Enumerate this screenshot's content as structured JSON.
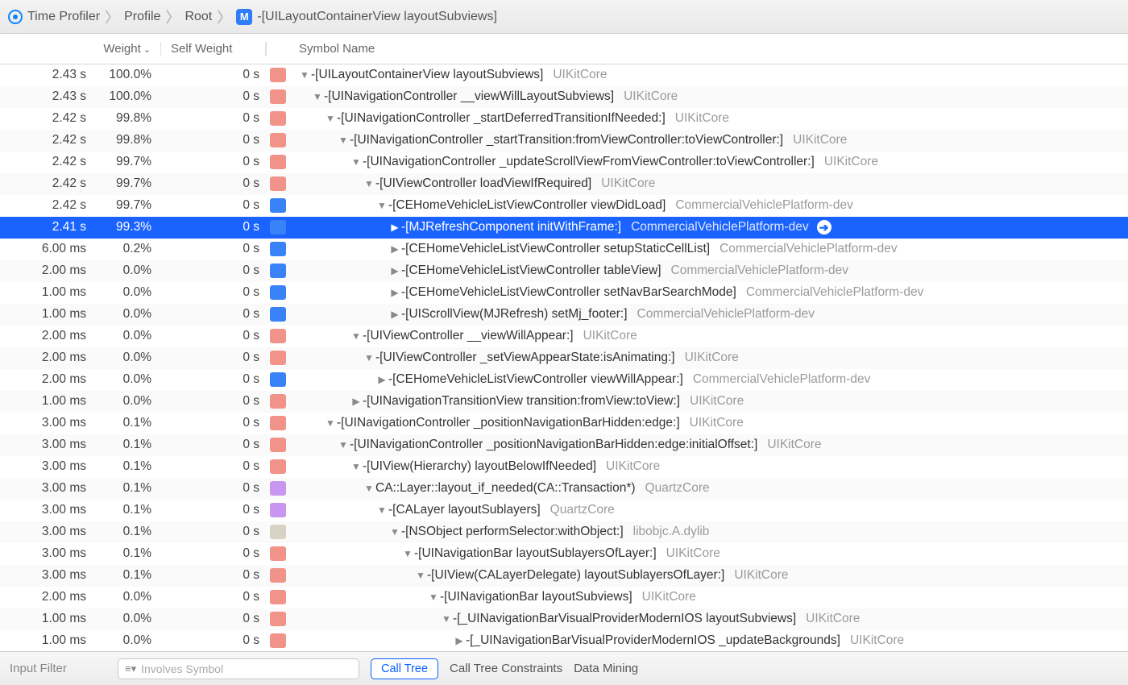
{
  "breadcrumb": {
    "items": [
      "Time Profiler",
      "Profile",
      "Root"
    ],
    "leaf_badge": "M",
    "leaf": "-[UILayoutContainerView layoutSubviews]"
  },
  "columns": {
    "weight": "Weight",
    "self": "Self Weight",
    "symbol": "Symbol Name"
  },
  "rows": [
    {
      "t": "2.43 s",
      "p": "100.0%",
      "s": "0 s",
      "ic": "sys",
      "d": 0,
      "e": "open",
      "sym": "-[UILayoutContainerView layoutSubviews]",
      "lib": "UIKitCore"
    },
    {
      "t": "2.43 s",
      "p": "100.0%",
      "s": "0 s",
      "ic": "sys",
      "d": 1,
      "e": "open",
      "sym": "-[UINavigationController __viewWillLayoutSubviews]",
      "lib": "UIKitCore"
    },
    {
      "t": "2.42 s",
      "p": "99.8%",
      "s": "0 s",
      "ic": "sys",
      "d": 2,
      "e": "open",
      "sym": "-[UINavigationController _startDeferredTransitionIfNeeded:]",
      "lib": "UIKitCore"
    },
    {
      "t": "2.42 s",
      "p": "99.8%",
      "s": "0 s",
      "ic": "sys",
      "d": 3,
      "e": "open",
      "sym": "-[UINavigationController _startTransition:fromViewController:toViewController:]",
      "lib": "UIKitCore"
    },
    {
      "t": "2.42 s",
      "p": "99.7%",
      "s": "0 s",
      "ic": "sys",
      "d": 4,
      "e": "open",
      "sym": "-[UINavigationController _updateScrollViewFromViewController:toViewController:]",
      "lib": "UIKitCore"
    },
    {
      "t": "2.42 s",
      "p": "99.7%",
      "s": "0 s",
      "ic": "sys",
      "d": 5,
      "e": "open",
      "sym": "-[UIViewController loadViewIfRequired]",
      "lib": "UIKitCore"
    },
    {
      "t": "2.42 s",
      "p": "99.7%",
      "s": "0 s",
      "ic": "app",
      "d": 6,
      "e": "open",
      "sym": "-[CEHomeVehicleListViewController viewDidLoad]",
      "lib": "CommercialVehiclePlatform-dev"
    },
    {
      "t": "2.41 s",
      "p": "99.3%",
      "s": "0 s",
      "ic": "app",
      "d": 7,
      "e": "closed",
      "sym": "-[MJRefreshComponent initWithFrame:]",
      "lib": "CommercialVehiclePlatform-dev",
      "sel": true,
      "go": true
    },
    {
      "t": "6.00 ms",
      "p": "0.2%",
      "s": "0 s",
      "ic": "app",
      "d": 7,
      "e": "closed",
      "sym": "-[CEHomeVehicleListViewController setupStaticCellList]",
      "lib": "CommercialVehiclePlatform-dev"
    },
    {
      "t": "2.00 ms",
      "p": "0.0%",
      "s": "0 s",
      "ic": "app",
      "d": 7,
      "e": "closed",
      "sym": "-[CEHomeVehicleListViewController tableView]",
      "lib": "CommercialVehiclePlatform-dev"
    },
    {
      "t": "1.00 ms",
      "p": "0.0%",
      "s": "0 s",
      "ic": "app",
      "d": 7,
      "e": "closed",
      "sym": "-[CEHomeVehicleListViewController setNavBarSearchMode]",
      "lib": "CommercialVehiclePlatform-dev"
    },
    {
      "t": "1.00 ms",
      "p": "0.0%",
      "s": "0 s",
      "ic": "app",
      "d": 7,
      "e": "closed",
      "sym": "-[UIScrollView(MJRefresh) setMj_footer:]",
      "lib": "CommercialVehiclePlatform-dev"
    },
    {
      "t": "2.00 ms",
      "p": "0.0%",
      "s": "0 s",
      "ic": "sys",
      "d": 4,
      "e": "open",
      "sym": "-[UIViewController __viewWillAppear:]",
      "lib": "UIKitCore"
    },
    {
      "t": "2.00 ms",
      "p": "0.0%",
      "s": "0 s",
      "ic": "sys",
      "d": 5,
      "e": "open",
      "sym": "-[UIViewController _setViewAppearState:isAnimating:]",
      "lib": "UIKitCore"
    },
    {
      "t": "2.00 ms",
      "p": "0.0%",
      "s": "0 s",
      "ic": "app",
      "d": 6,
      "e": "closed",
      "sym": "-[CEHomeVehicleListViewController viewWillAppear:]",
      "lib": "CommercialVehiclePlatform-dev"
    },
    {
      "t": "1.00 ms",
      "p": "0.0%",
      "s": "0 s",
      "ic": "sys",
      "d": 4,
      "e": "closed",
      "sym": "-[UINavigationTransitionView transition:fromView:toView:]",
      "lib": "UIKitCore"
    },
    {
      "t": "3.00 ms",
      "p": "0.1%",
      "s": "0 s",
      "ic": "sys",
      "d": 2,
      "e": "open",
      "sym": "-[UINavigationController _positionNavigationBarHidden:edge:]",
      "lib": "UIKitCore"
    },
    {
      "t": "3.00 ms",
      "p": "0.1%",
      "s": "0 s",
      "ic": "sys",
      "d": 3,
      "e": "open",
      "sym": "-[UINavigationController _positionNavigationBarHidden:edge:initialOffset:]",
      "lib": "UIKitCore"
    },
    {
      "t": "3.00 ms",
      "p": "0.1%",
      "s": "0 s",
      "ic": "sys",
      "d": 4,
      "e": "open",
      "sym": "-[UIView(Hierarchy) layoutBelowIfNeeded]",
      "lib": "UIKitCore"
    },
    {
      "t": "3.00 ms",
      "p": "0.1%",
      "s": "0 s",
      "ic": "qc",
      "d": 5,
      "e": "open",
      "sym": "CA::Layer::layout_if_needed(CA::Transaction*)",
      "lib": "QuartzCore"
    },
    {
      "t": "3.00 ms",
      "p": "0.1%",
      "s": "0 s",
      "ic": "qc",
      "d": 6,
      "e": "open",
      "sym": "-[CALayer layoutSublayers]",
      "lib": "QuartzCore"
    },
    {
      "t": "3.00 ms",
      "p": "0.1%",
      "s": "0 s",
      "ic": "objc",
      "d": 7,
      "e": "open",
      "sym": "-[NSObject performSelector:withObject:]",
      "lib": "libobjc.A.dylib"
    },
    {
      "t": "3.00 ms",
      "p": "0.1%",
      "s": "0 s",
      "ic": "sys",
      "d": 8,
      "e": "open",
      "sym": "-[UINavigationBar layoutSublayersOfLayer:]",
      "lib": "UIKitCore"
    },
    {
      "t": "3.00 ms",
      "p": "0.1%",
      "s": "0 s",
      "ic": "sys",
      "d": 9,
      "e": "open",
      "sym": "-[UIView(CALayerDelegate) layoutSublayersOfLayer:]",
      "lib": "UIKitCore"
    },
    {
      "t": "2.00 ms",
      "p": "0.0%",
      "s": "0 s",
      "ic": "sys",
      "d": 10,
      "e": "open",
      "sym": "-[UINavigationBar layoutSubviews]",
      "lib": "UIKitCore"
    },
    {
      "t": "1.00 ms",
      "p": "0.0%",
      "s": "0 s",
      "ic": "sys",
      "d": 11,
      "e": "open",
      "sym": "-[_UINavigationBarVisualProviderModernIOS layoutSubviews]",
      "lib": "UIKitCore"
    },
    {
      "t": "1.00 ms",
      "p": "0.0%",
      "s": "0 s",
      "ic": "sys",
      "d": 12,
      "e": "closed",
      "sym": "-[_UINavigationBarVisualProviderModernIOS _updateBackgrounds]",
      "lib": "UIKitCore"
    }
  ],
  "bottom": {
    "input_filter": "Input Filter",
    "involves_placeholder": "Involves Symbol",
    "call_tree": "Call Tree",
    "constraints": "Call Tree Constraints",
    "data_mining": "Data Mining"
  }
}
